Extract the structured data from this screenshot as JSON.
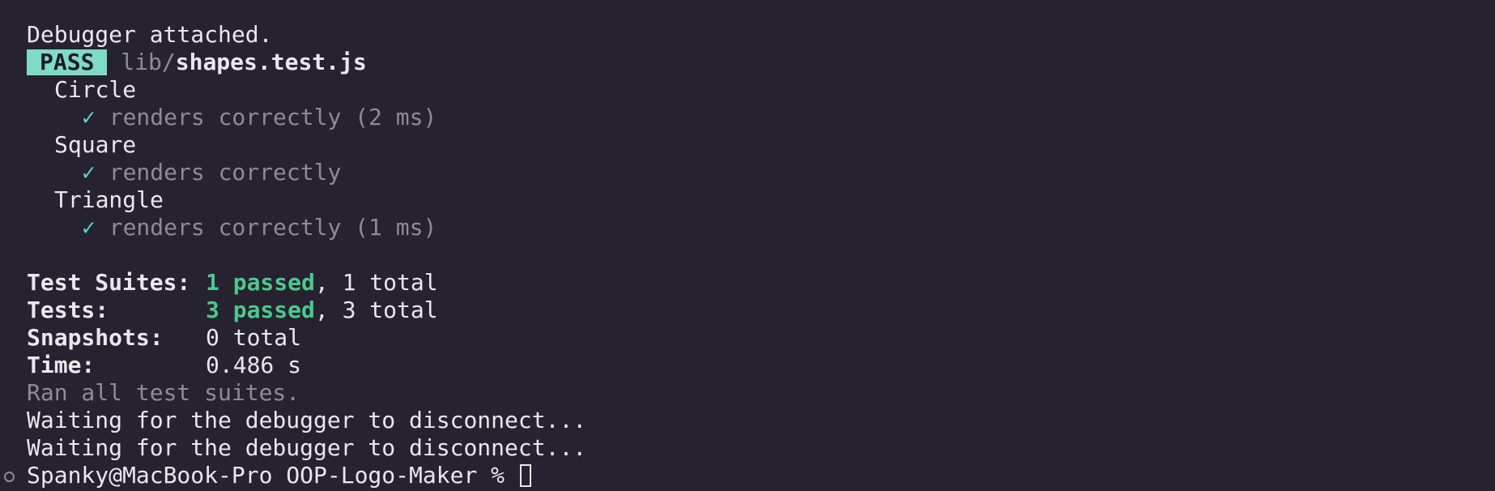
{
  "output": {
    "debugger_attached": "Debugger attached.",
    "badge": "PASS",
    "file_dir": "lib/",
    "file_name": "shapes.test.js",
    "groups": [
      {
        "name": "Circle",
        "check": "✓",
        "test": "renders correctly (2 ms)"
      },
      {
        "name": "Square",
        "check": "✓",
        "test": "renders correctly"
      },
      {
        "name": "Triangle",
        "check": "✓",
        "test": "renders correctly (1 ms)"
      }
    ],
    "summary": {
      "suites_label": "Test Suites:",
      "suites_passed": "1 passed",
      "suites_total": ", 1 total",
      "tests_label": "Tests:",
      "tests_passed": "3 passed",
      "tests_total": ", 3 total",
      "snapshots_label": "Snapshots:",
      "snapshots_value": "0 total",
      "time_label": "Time:",
      "time_value": "0.486 s"
    },
    "ran_all": "Ran all test suites.",
    "waiting_1": "Waiting for the debugger to disconnect...",
    "waiting_2": "Waiting for the debugger to disconnect..."
  },
  "prompt": {
    "text": "Spanky@MacBook-Pro OOP-Logo-Maker % "
  },
  "colors": {
    "background": "#262230",
    "foreground": "#e8e8ec",
    "pass_badge": "#7fdcc4",
    "passed_green": "#4cc88f",
    "check_teal": "#56d6c4",
    "dim": "#8e8b98"
  }
}
